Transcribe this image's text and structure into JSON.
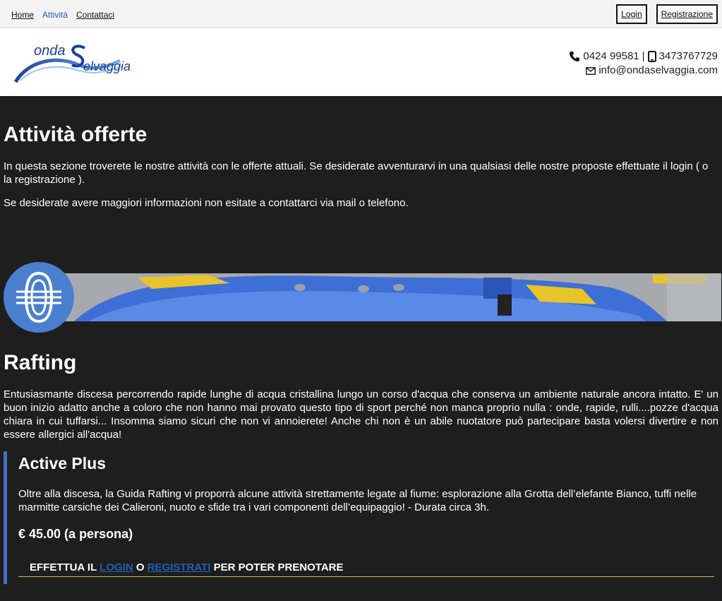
{
  "nav": {
    "home": "Home",
    "attivita": "Attività",
    "contattaci": "Contattaci"
  },
  "auth": {
    "login": "Login",
    "registrazione": "Registrazione"
  },
  "contacts": {
    "phone": "0424 99581",
    "separator": "|",
    "mobile": "3473767729",
    "email": "info@ondaselvaggia.com"
  },
  "page": {
    "title": "Attività offerte",
    "intro1": "In questa sezione troverete le nostre attività con le offerte attuali. Se desiderate avventurarvi in una qualsiasi delle nostre proposte effettuate il login ( o la registrazione ).",
    "intro2": "Se desiderate avere maggiori informazioni non esitate a contattarci via mail o telefono."
  },
  "activity": {
    "name": "Rafting",
    "description": "Entusiasmante discesa percorrendo rapide lunghe di acqua cristallina lungo un corso d'acqua che conserva un ambiente naturale ancora intatto. E' un buon inizio adatto anche a coloro che non hanno mai provato questo tipo di sport perché non manca proprio nulla : onde, rapide, rulli....pozze d'acqua chiara in cui tuffarsi... Insomma siamo sicuri che non vi annoierete! Anche chi non è un abile nuotatore può partecipare basta volersi divertire e non essere allergici all'acqua!",
    "offer": {
      "name": "Active Plus",
      "description": "Oltre alla discesa, la Guida Rafting vi proporrà alcune attività strettamente legate al fiume: esplorazione alla Grotta dell’elefante Bianco, tuffi nelle marmitte carsiche dei Calieroni, nuoto e sfide tra i vari componenti dell’equipaggio! - Durata circa 3h.",
      "price": "€ 45.00 (a persona)",
      "cta_prefix": "EFFETTUA IL",
      "cta_login": "LOGIN",
      "cta_or": "O",
      "cta_register": "REGISTRATI",
      "cta_suffix": "PER POTER PRENOTARE"
    }
  },
  "icons": {
    "phone": "phone-icon",
    "mobile": "mobile-icon",
    "email": "envelope-icon",
    "raft": "raft-icon"
  },
  "colors": {
    "background": "#1e1e1e",
    "accent": "#4a7fcf",
    "link": "#1f5fb4"
  }
}
